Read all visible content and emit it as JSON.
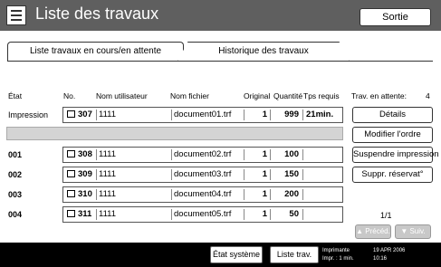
{
  "header": {
    "title": "Liste des travaux",
    "exit_label": "Sortie"
  },
  "tabs": [
    {
      "label": "Liste travaux en cours/en attente",
      "active": true
    },
    {
      "label": "Historique des travaux",
      "active": false
    }
  ],
  "columns": {
    "state": "État",
    "no": "No.",
    "user": "Nom utilisateur",
    "file": "Nom fichier",
    "original": "Original",
    "quantity": "Quantité",
    "time_required": "Tps requis"
  },
  "current_job": {
    "state": "Impression",
    "no": "307",
    "user": "1111",
    "file": "document01.trf",
    "original": "1",
    "quantity": "999",
    "time": "21min."
  },
  "queued_jobs": [
    {
      "state": "001",
      "no": "308",
      "user": "1111",
      "file": "document02.trf",
      "original": "1",
      "quantity": "100"
    },
    {
      "state": "002",
      "no": "309",
      "user": "1111",
      "file": "document03.trf",
      "original": "1",
      "quantity": "150"
    },
    {
      "state": "003",
      "no": "310",
      "user": "1111",
      "file": "document04.trf",
      "original": "1",
      "quantity": "200"
    },
    {
      "state": "004",
      "no": "311",
      "user": "1111",
      "file": "document05.trf",
      "original": "1",
      "quantity": "50"
    }
  ],
  "side_panel": {
    "waiting_label": "Trav. en attente:",
    "waiting_count": "4",
    "details": "Détails",
    "change_order": "Modifier l'ordre",
    "suspend_print": "Suspendre impression",
    "cancel_reservation": "Suppr. réservat°"
  },
  "pagination": {
    "indicator": "1/1",
    "prev": "Précéd.",
    "next": "Suiv."
  },
  "statusbar": {
    "system_status": "État système",
    "job_list": "Liste trav.",
    "printer_label": "Imprimante",
    "printer_mode": "Impr. : 1 min.",
    "date": "19 APR 2006",
    "time": "10:16"
  }
}
